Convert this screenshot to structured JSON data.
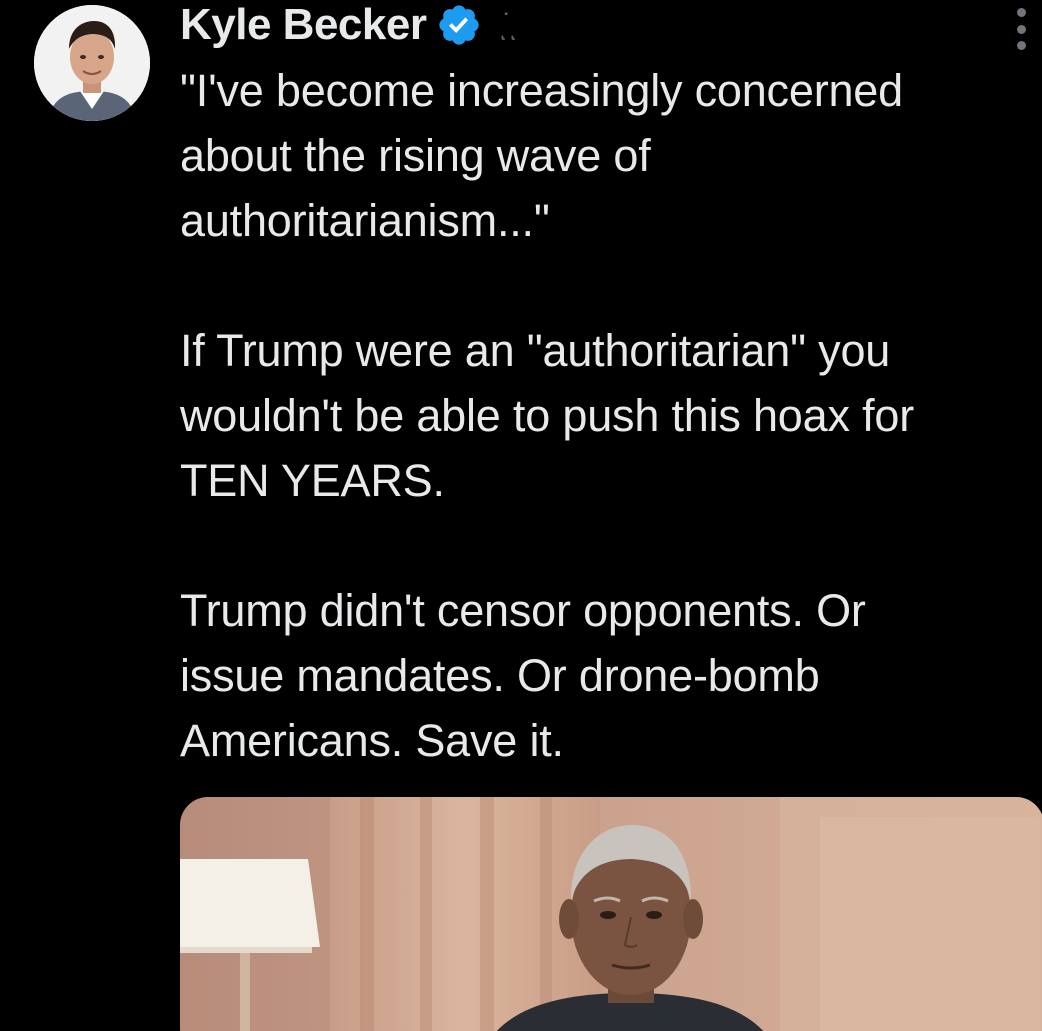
{
  "author": {
    "name": "Kyle Becker",
    "handle_fragment": "ͅ˙ͅ",
    "verified": true,
    "avatar_icon": "profile-photo",
    "verified_color": "#1d9bf0"
  },
  "tweet": {
    "paragraphs": [
      {
        "lines": [
          "\"I've become increasingly concerned",
          "about the rising wave of",
          "authoritarianism...\""
        ]
      },
      {
        "lines": [
          "If Trump were an \"authoritarian\" you",
          "wouldn't be able to push this hoax for",
          "TEN YEARS."
        ]
      },
      {
        "lines": [
          "Trump didn't censor opponents. Or",
          "issue mandates. Or drone-bomb",
          "Americans. Save it."
        ]
      }
    ]
  },
  "menu": {
    "icon": "more-options-icon"
  },
  "media": {
    "type": "video-thumbnail"
  },
  "colors": {
    "background": "#000000",
    "text": "#e7e9ea",
    "secondary": "#71767b"
  }
}
